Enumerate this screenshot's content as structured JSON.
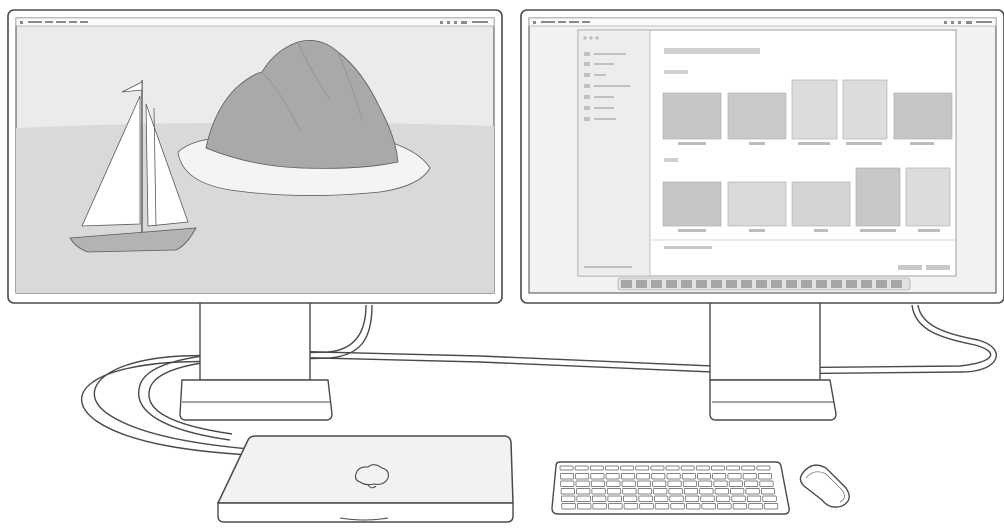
{
  "scene": {
    "left_display": {
      "menubar": {
        "items": [
          "apple-menu",
          "app-name",
          "file",
          "edit",
          "view",
          "help"
        ],
        "status_items": [
          "control-center",
          "wifi",
          "search",
          "battery",
          "clock"
        ]
      },
      "wallpaper": {
        "subjects": [
          "sailboat",
          "rocky-island",
          "sea",
          "sky"
        ]
      }
    },
    "right_display": {
      "menubar": {
        "items": [
          "apple-menu",
          "app-name",
          "file",
          "edit",
          "view",
          "help"
        ],
        "status_items": [
          "control-center",
          "wifi",
          "search",
          "battery",
          "clock"
        ]
      },
      "window": {
        "sidebar": {
          "row_count": 7,
          "traffic_lights": 3
        },
        "sections": [
          {
            "thumbnails": [
              "landscape",
              "landscape",
              "portrait",
              "portrait",
              "landscape"
            ]
          },
          {
            "thumbnails": [
              "landscape",
              "landscape",
              "landscape",
              "portrait",
              "portrait"
            ]
          }
        ]
      },
      "dock": {
        "icon_count": 19
      }
    },
    "accessories": [
      "macbook-closed",
      "magic-keyboard",
      "magic-mouse"
    ],
    "colors": {
      "outline": "#4a4a4a",
      "bezel": "#ffffff",
      "sky": "#ebebeb",
      "sea": "#d9d9d9",
      "rock": "#a9a9a9",
      "sand": "#f4f4f4",
      "screen_bg": "#f2f2f2",
      "thumb_dark": "#c6c6c6",
      "thumb_light": "#dcdcdc",
      "device_fill": "#f2f2f2"
    }
  }
}
